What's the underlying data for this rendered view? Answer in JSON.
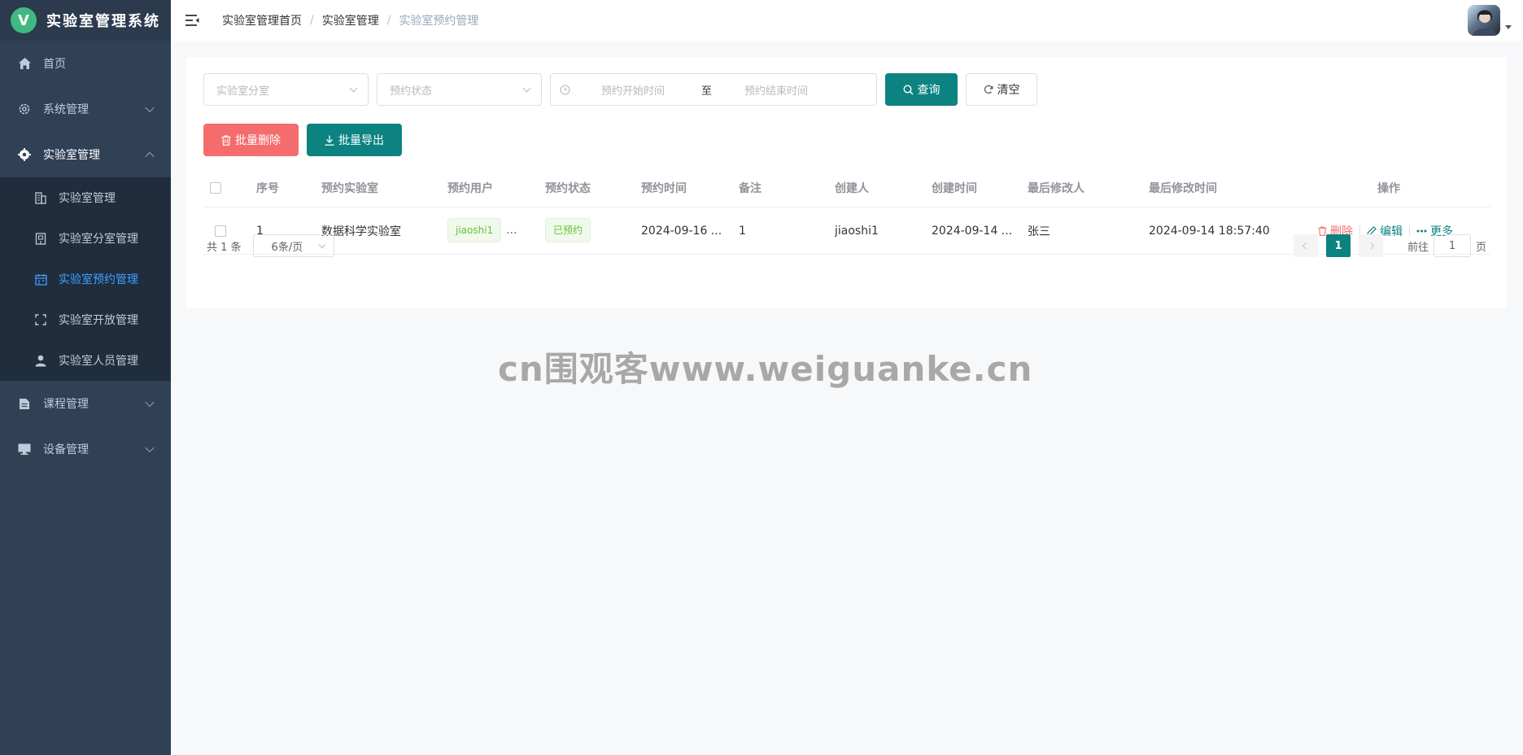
{
  "brand": {
    "logo_letter": "V",
    "title": "实验室管理系统"
  },
  "sidebar": {
    "items": [
      {
        "label": "首页",
        "icon": "home-icon"
      },
      {
        "label": "系统管理",
        "icon": "gear-icon"
      },
      {
        "label": "实验室管理",
        "icon": "cog-icon"
      },
      {
        "label": "课程管理",
        "icon": "document-icon"
      },
      {
        "label": "设备管理",
        "icon": "monitor-icon"
      }
    ],
    "submenu": [
      {
        "label": "实验室管理",
        "icon": "building-icon"
      },
      {
        "label": "实验室分室管理",
        "icon": "room-icon"
      },
      {
        "label": "实验室预约管理",
        "icon": "calendar-icon"
      },
      {
        "label": "实验室开放管理",
        "icon": "fullscreen-icon"
      },
      {
        "label": "实验室人员管理",
        "icon": "user-icon"
      }
    ]
  },
  "breadcrumb": {
    "home": "实验室管理首页",
    "parent": "实验室管理",
    "current": "实验室预约管理"
  },
  "filters": {
    "room_placeholder": "实验室分室",
    "status_placeholder": "预约状态",
    "start_placeholder": "预约开始时间",
    "range_sep": "至",
    "end_placeholder": "预约结束时间",
    "search_label": "查询",
    "clear_label": "清空"
  },
  "actions": {
    "batch_delete": "批量删除",
    "batch_export": "批量导出"
  },
  "table": {
    "headers": [
      "序号",
      "预约实验室",
      "预约用户",
      "预约状态",
      "预约时间",
      "备注",
      "创建人",
      "创建时间",
      "最后修改人",
      "最后修改时间",
      "操作"
    ],
    "rows": [
      {
        "index": "1",
        "lab": "数据科学实验室",
        "user_tag": "jiaoshi1",
        "user_more": "...",
        "status": "已预约",
        "time": "2024-09-16 ...",
        "remark": "1",
        "creator": "jiaoshi1",
        "created": "2024-09-14 ...",
        "modifier": "张三",
        "modified": "2024-09-14 18:57:40",
        "op_delete": "删除",
        "op_edit": "编辑",
        "op_more": "更多"
      }
    ]
  },
  "pagination": {
    "total": "共 1 条",
    "page_size": "6条/页",
    "current_page": "1",
    "goto_prefix": "前往",
    "goto_value": "1",
    "goto_suffix": "页"
  },
  "watermark": "cn围观客www.weiguanke.cn",
  "colors": {
    "sidebar": "#304156",
    "submenu": "#1f2d3d",
    "accent": "#0c8381",
    "danger": "#f56c6c",
    "active": "#409eff"
  }
}
